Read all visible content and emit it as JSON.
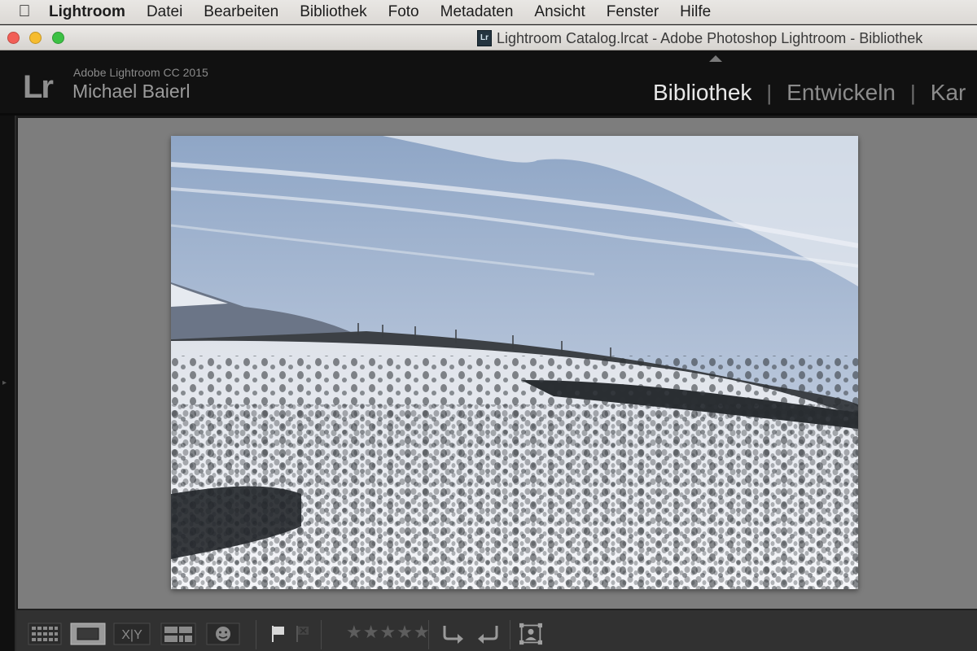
{
  "menubar": {
    "apple_icon": "apple-logo-icon",
    "items": [
      "Lightroom",
      "Datei",
      "Bearbeiten",
      "Bibliothek",
      "Foto",
      "Metadaten",
      "Ansicht",
      "Fenster",
      "Hilfe"
    ]
  },
  "window": {
    "title": "Lightroom Catalog.lrcat - Adobe Photoshop Lightroom - Bibliothek",
    "doc_icon_label": "Lr"
  },
  "identity": {
    "logo": "Lr",
    "product": "Adobe Lightroom CC 2015",
    "user": "Michael Baierl"
  },
  "modules": {
    "active": "Bibliothek",
    "items": [
      "Bibliothek",
      "Entwickeln",
      "Kar"
    ]
  },
  "toolbar": {
    "buttons": [
      "grid-view-icon",
      "loupe-view-icon",
      "compare-view-icon",
      "survey-view-icon",
      "people-view-icon",
      "pick-flag-icon",
      "reject-flag-icon",
      "rotate-left-icon",
      "rotate-right-icon",
      "crop-overlay-icon"
    ],
    "compare_label": "X|Y",
    "stars": "★★★★★"
  },
  "colors": {
    "accent_active": "#e8e8e8",
    "loupe_bg": "#7d7d7d",
    "traffic_close": "#f25e56",
    "traffic_min": "#f6bc2f",
    "traffic_max": "#3cc144"
  }
}
